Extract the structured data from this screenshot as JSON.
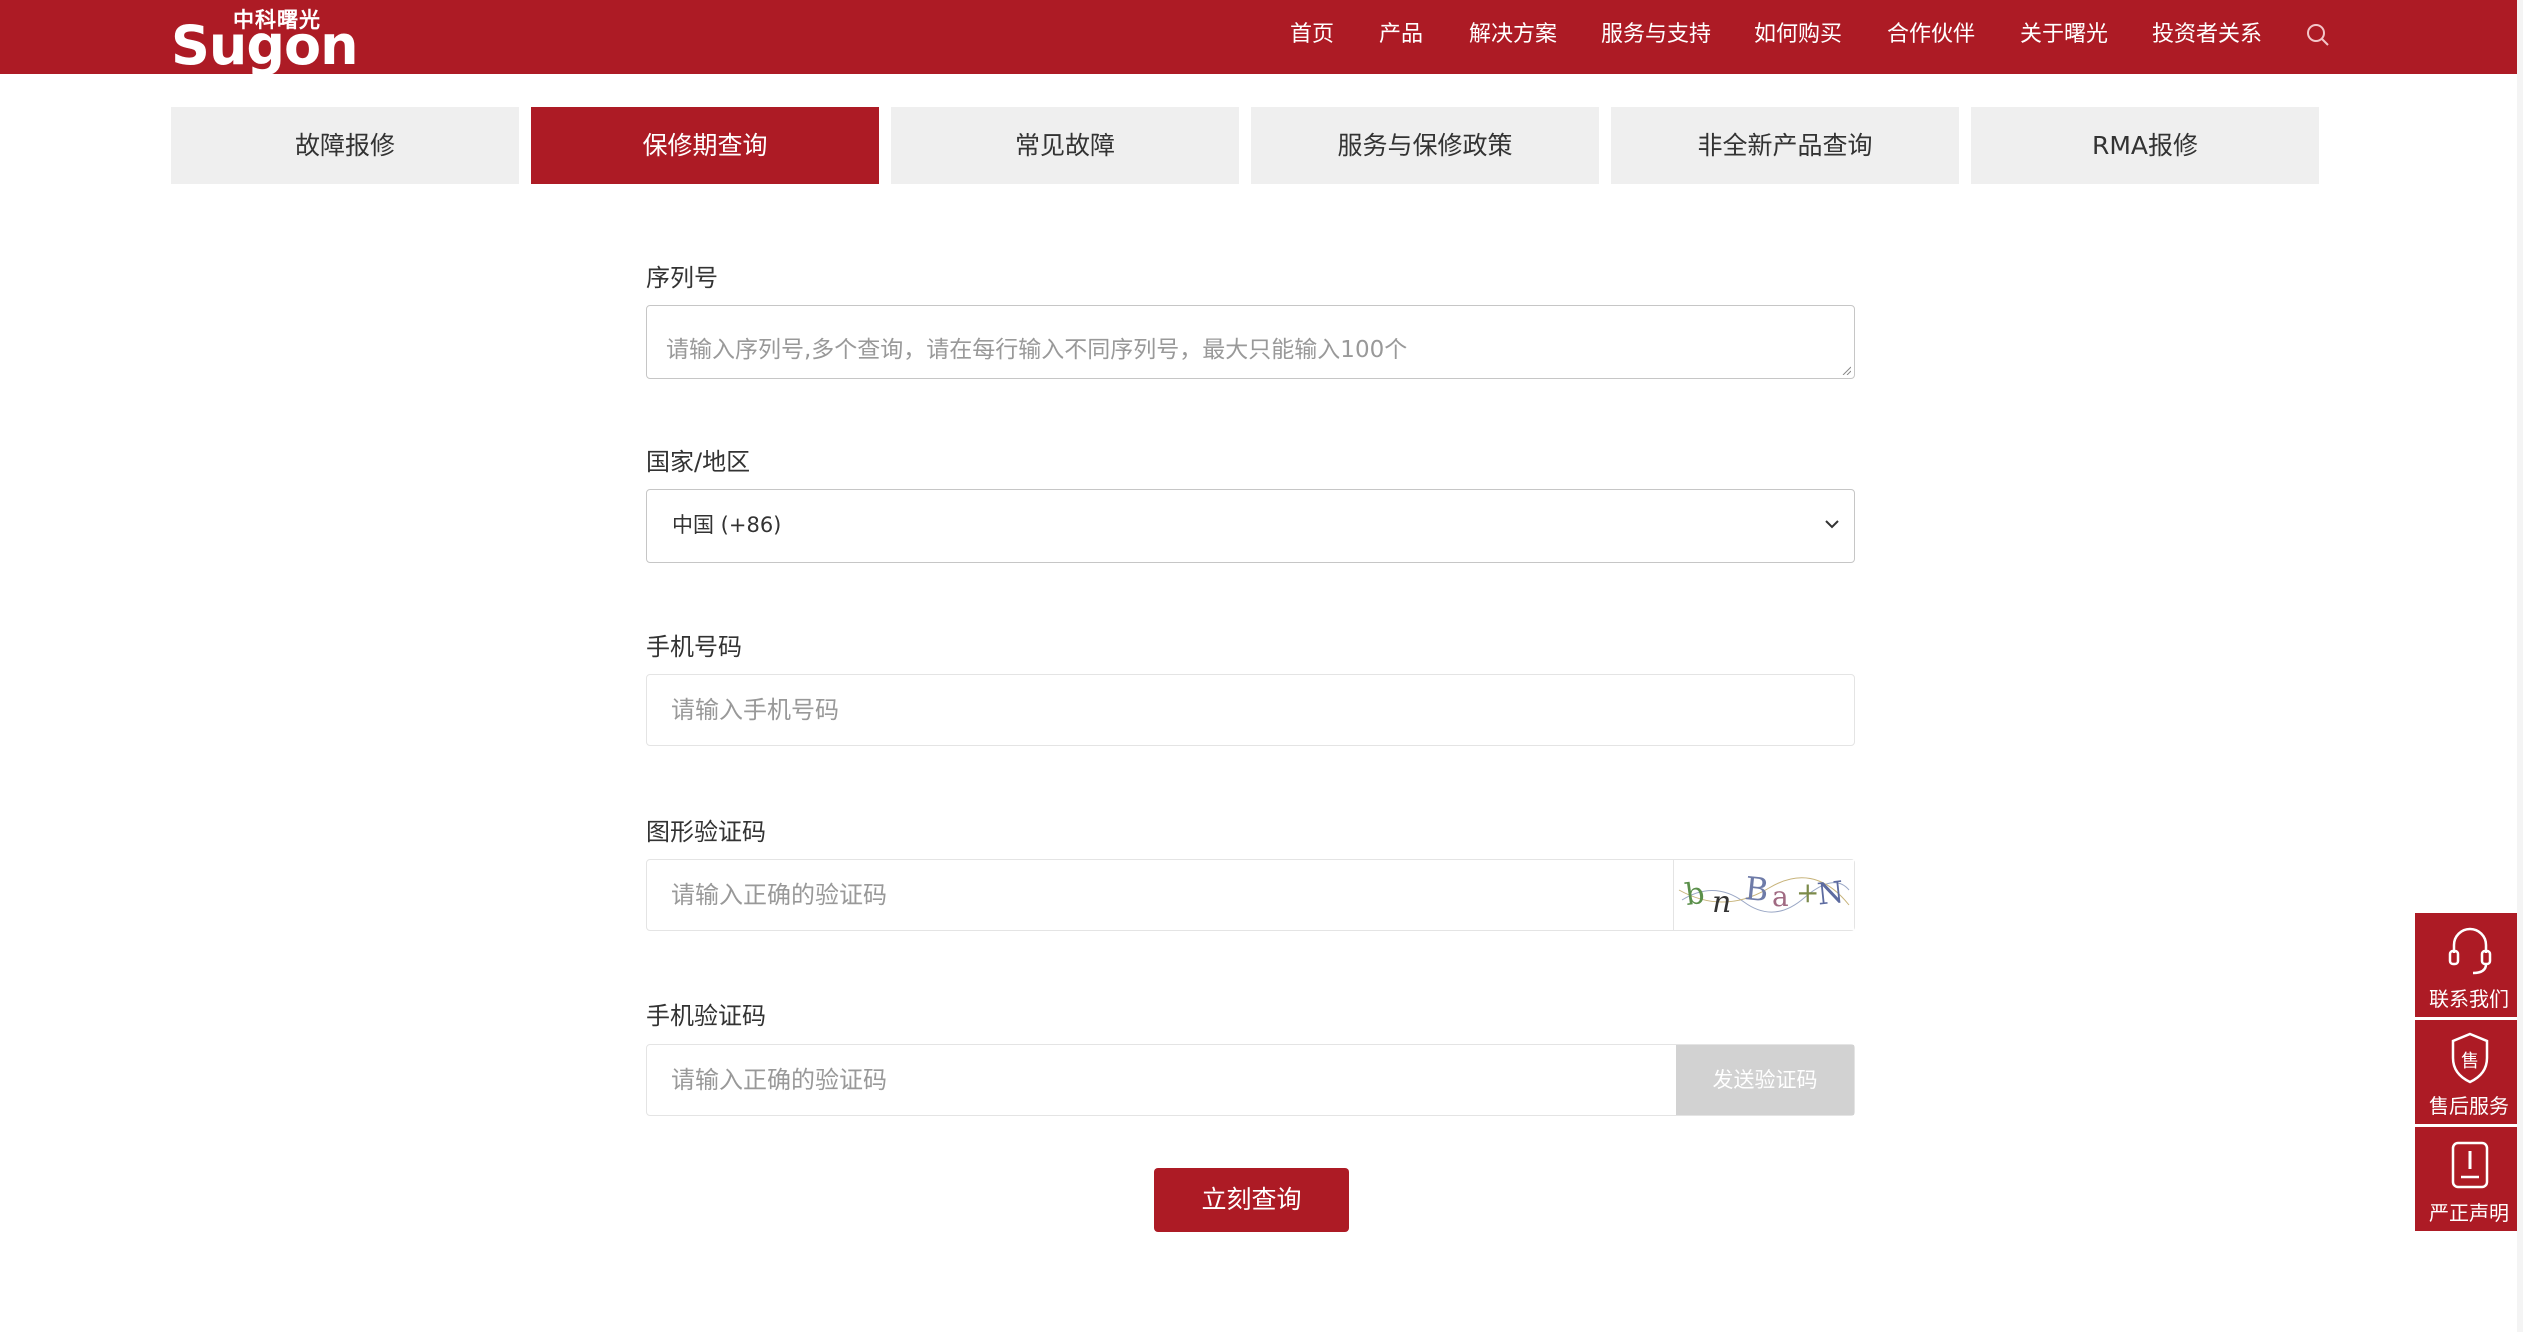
{
  "brand": {
    "logo_cn": "中科曙光",
    "logo_en": "Sugon",
    "primary_color": "#ad1b25"
  },
  "nav": {
    "items": [
      "首页",
      "产品",
      "解决方案",
      "服务与支持",
      "如何购买",
      "合作伙伴",
      "关于曙光",
      "投资者关系"
    ],
    "search_icon": "search-icon"
  },
  "tabs": {
    "items": [
      "故障报修",
      "保修期查询",
      "常见故障",
      "服务与保修政策",
      "非全新产品查询",
      "RMA报修"
    ],
    "active": "保修期查询"
  },
  "form": {
    "serial": {
      "label": "序列号",
      "placeholder": "请输入序列号,多个查询，请在每行输入不同序列号，最大只能输入100个"
    },
    "country": {
      "label": "国家/地区",
      "value": "中国 (+86)"
    },
    "phone": {
      "label": "手机号码",
      "placeholder": "请输入手机号码"
    },
    "captcha": {
      "label": "图形验证码",
      "placeholder": "请输入正确的验证码",
      "image_text": "bnBa+N"
    },
    "sms": {
      "label": "手机验证码",
      "placeholder": "请输入正确的验证码",
      "send_label": "发送验证码"
    },
    "submit_label": "立刻查询"
  },
  "side": {
    "items": [
      {
        "label": "联系我们",
        "icon": "headset-icon"
      },
      {
        "label": "售后服务",
        "icon": "shield-icon"
      },
      {
        "label": "严正声明",
        "icon": "notice-icon"
      }
    ]
  }
}
